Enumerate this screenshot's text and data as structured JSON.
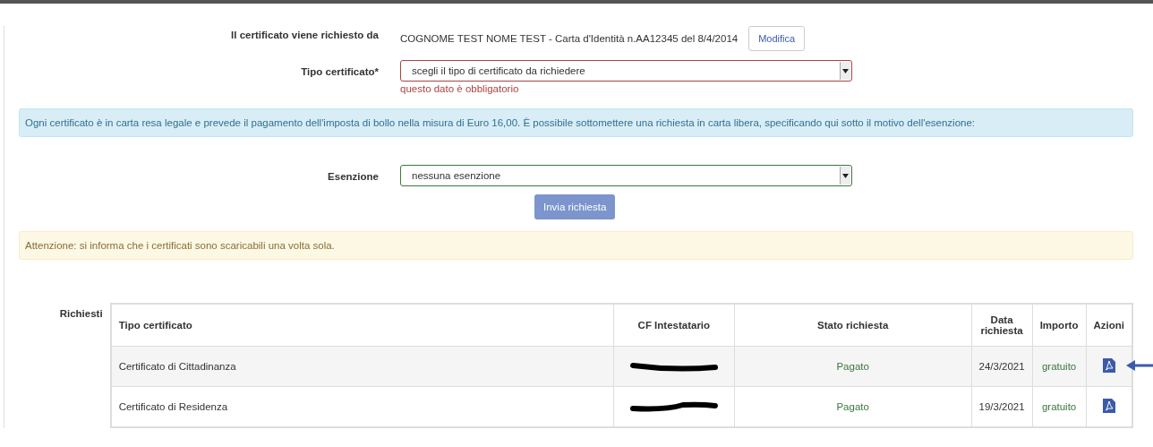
{
  "requester": {
    "label": "Il certificato viene richiesto da",
    "value": "COGNOME TEST NOME TEST - Carta d'Identità n.AA12345 del 8/4/2014",
    "button": "Modifica"
  },
  "certificate_type": {
    "label": "Tipo certificato*",
    "value": "scegli il tipo di certificato da richiedere",
    "error": "questo dato è obbligatorio"
  },
  "info_notice": "Ogni certificato è in carta resa legale e prevede il pagamento dell'imposta di bollo nella misura di Euro 16,00. È possibile sottomettere una richiesta in carta libera, specificando qui sotto il motivo dell'esenzione:",
  "exemption": {
    "label": "Esenzione",
    "value": "nessuna esenzione"
  },
  "submit_button": {
    "label": "Invia richiesta",
    "disabled": true
  },
  "warning_notice": "Attenzione: si informa che i certificati sono scaricabili una volta sola.",
  "requests": {
    "label": "Richiesti",
    "columns": [
      "Tipo certificato",
      "CF Intestatario",
      "Stato richiesta",
      "Data richiesta",
      "Importo",
      "Azioni"
    ],
    "rows": [
      {
        "type": "Certificato di Cittadinanza",
        "status": "Pagato",
        "date": "24/3/2021",
        "amount": "gratuito",
        "highlighted": true
      },
      {
        "type": "Certificato di Residenza",
        "status": "Pagato",
        "date": "19/3/2021",
        "amount": "gratuito",
        "highlighted": false
      }
    ]
  }
}
